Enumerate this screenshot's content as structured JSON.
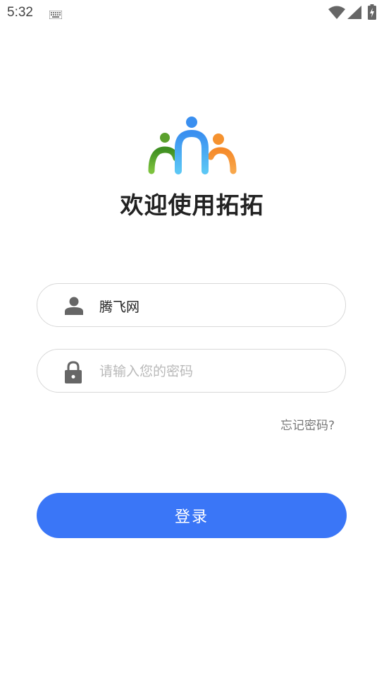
{
  "status_bar": {
    "time": "5:32",
    "icons": [
      "keyboard-icon",
      "wifi-icon",
      "cell-signal-icon",
      "battery-charging-icon"
    ]
  },
  "logo": {
    "icon": "people-logo-icon",
    "colors": [
      "#5aa02c",
      "#3a8ff0",
      "#f5922f"
    ]
  },
  "welcome": {
    "title": "欢迎使用拓拓"
  },
  "username": {
    "icon": "user-icon",
    "value": "腾飞网"
  },
  "password": {
    "icon": "lock-icon",
    "value": "",
    "placeholder": "请输入您的密码"
  },
  "forgot_password": {
    "label": "忘记密码?"
  },
  "login": {
    "label": "登录",
    "color": "#3a76f7"
  }
}
